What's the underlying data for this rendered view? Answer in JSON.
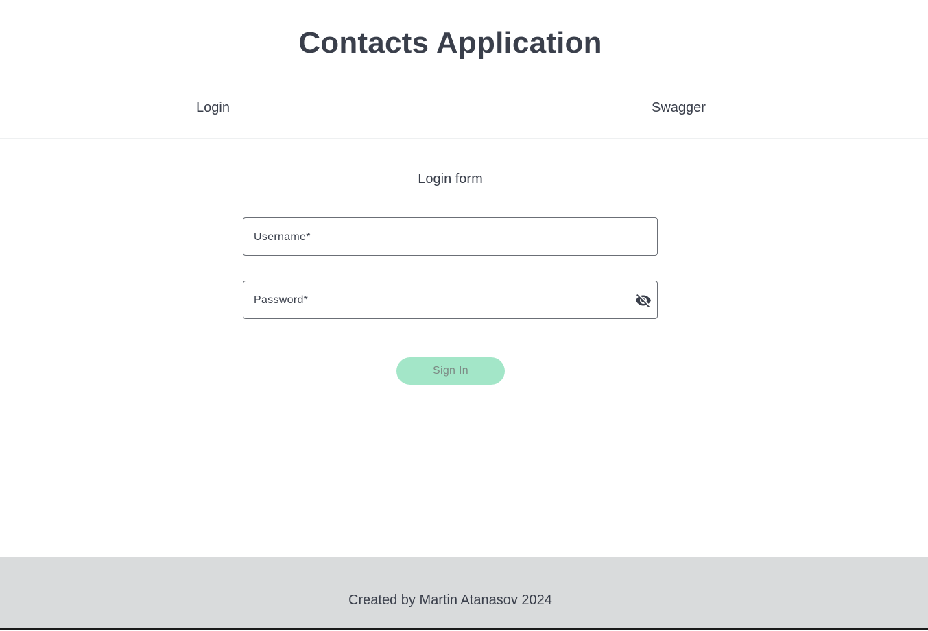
{
  "header": {
    "title": "Contacts Application"
  },
  "nav": {
    "login_label": "Login",
    "swagger_label": "Swagger"
  },
  "form": {
    "title": "Login form",
    "username_label": "Username*",
    "password_label": "Password*",
    "password_toggle_icon": "eye-off-icon",
    "submit_label": "Sign In"
  },
  "footer": {
    "text": "Created by Martin Atanasov 2024"
  },
  "colors": {
    "text": "#3a3f4b",
    "button_bg": "#a3e6c8",
    "button_text": "#7d8a85",
    "footer_bg": "#d9dbdc"
  }
}
